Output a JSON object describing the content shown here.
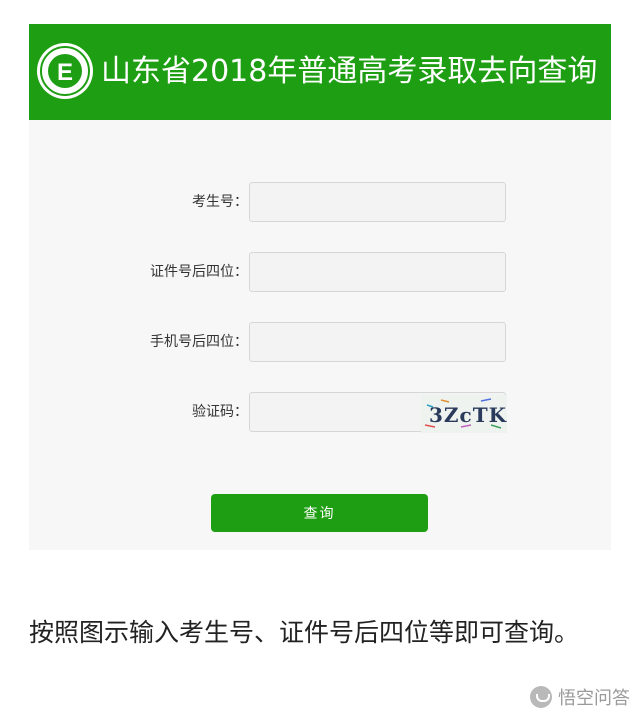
{
  "header": {
    "title": "山东省2018年普通高考录取去向查询"
  },
  "form": {
    "exam_number_label": "考生号：",
    "id_last4_label": "证件号后四位：",
    "phone_last4_label": "手机号后四位：",
    "captcha_label": "验证码：",
    "captcha_text": "3ZcTK",
    "submit_label": "查询"
  },
  "caption": "按照图示输入考生号、证件号后四位等即可查询。",
  "watermark": "悟空问答",
  "colors": {
    "brand_green": "#1e9e12"
  }
}
